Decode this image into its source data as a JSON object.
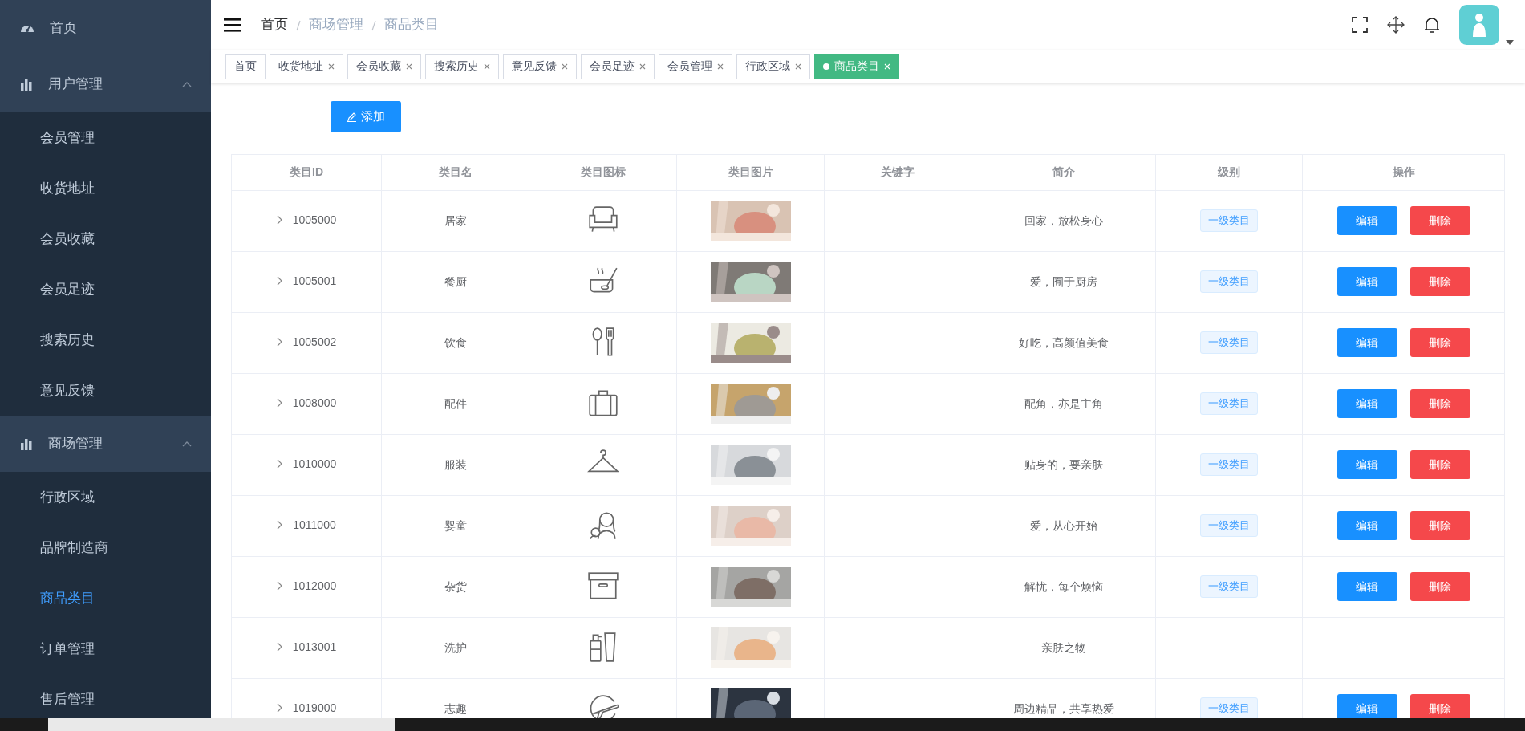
{
  "sidebar": {
    "items": [
      {
        "label": "首页",
        "kind": "link"
      },
      {
        "label": "用户管理",
        "kind": "group",
        "expanded": true,
        "children": [
          {
            "label": "会员管理",
            "selected": false
          },
          {
            "label": "收货地址",
            "selected": false
          },
          {
            "label": "会员收藏",
            "selected": false
          },
          {
            "label": "会员足迹",
            "selected": false
          },
          {
            "label": "搜索历史",
            "selected": false
          },
          {
            "label": "意见反馈",
            "selected": false
          }
        ]
      },
      {
        "label": "商场管理",
        "kind": "group",
        "expanded": true,
        "children": [
          {
            "label": "行政区域",
            "selected": false
          },
          {
            "label": "品牌制造商",
            "selected": false
          },
          {
            "label": "商品类目",
            "selected": true
          },
          {
            "label": "订单管理",
            "selected": false
          },
          {
            "label": "售后管理",
            "selected": false
          }
        ]
      }
    ]
  },
  "breadcrumb": [
    {
      "label": "首页",
      "link": true
    },
    {
      "label": "商场管理",
      "link": false
    },
    {
      "label": "商品类目",
      "link": false
    }
  ],
  "tabs": [
    {
      "label": "首页",
      "selected": false,
      "closable": false
    },
    {
      "label": "收货地址",
      "selected": false,
      "closable": true
    },
    {
      "label": "会员收藏",
      "selected": false,
      "closable": true
    },
    {
      "label": "搜索历史",
      "selected": false,
      "closable": true
    },
    {
      "label": "意见反馈",
      "selected": false,
      "closable": true
    },
    {
      "label": "会员足迹",
      "selected": false,
      "closable": true
    },
    {
      "label": "会员管理",
      "selected": false,
      "closable": true
    },
    {
      "label": "行政区域",
      "selected": false,
      "closable": true
    },
    {
      "label": "商品类目",
      "selected": true,
      "closable": true
    }
  ],
  "toolbar": {
    "add_button": "添加"
  },
  "table": {
    "columns": [
      "类目ID",
      "类目名",
      "类目图标",
      "类目图片",
      "关键字",
      "简介",
      "级别",
      "操作"
    ],
    "rows": [
      {
        "id": "1005000",
        "name": "居家",
        "description": "回家，放松身心",
        "level_tag": "一级类目",
        "actions": [
          {
            "label": "编辑",
            "kind": "edit"
          },
          {
            "label": "删除",
            "kind": "delete"
          }
        ]
      },
      {
        "id": "1005001",
        "name": "餐厨",
        "description": "爱，囿于厨房",
        "level_tag": "一级类目",
        "actions": [
          {
            "label": "编辑",
            "kind": "edit"
          },
          {
            "label": "删除",
            "kind": "delete"
          }
        ]
      },
      {
        "id": "1005002",
        "name": "饮食",
        "description": "好吃，高颜值美食",
        "level_tag": "一级类目",
        "actions": [
          {
            "label": "编辑",
            "kind": "edit"
          },
          {
            "label": "删除",
            "kind": "delete"
          }
        ]
      },
      {
        "id": "1008000",
        "name": "配件",
        "description": "配角，亦是主角",
        "level_tag": "一级类目",
        "actions": [
          {
            "label": "编辑",
            "kind": "edit"
          },
          {
            "label": "删除",
            "kind": "delete"
          }
        ]
      },
      {
        "id": "1010000",
        "name": "服装",
        "description": "贴身的，要亲肤",
        "level_tag": "一级类目",
        "actions": [
          {
            "label": "编辑",
            "kind": "edit"
          },
          {
            "label": "删除",
            "kind": "delete"
          }
        ]
      },
      {
        "id": "1011000",
        "name": "婴童",
        "description": "爱，从心开始",
        "level_tag": "一级类目",
        "actions": [
          {
            "label": "编辑",
            "kind": "edit"
          },
          {
            "label": "删除",
            "kind": "delete"
          }
        ]
      },
      {
        "id": "1012000",
        "name": "杂货",
        "description": "解忧，每个烦恼",
        "level_tag": "一级类目",
        "actions": [
          {
            "label": "编辑",
            "kind": "edit"
          },
          {
            "label": "删除",
            "kind": "delete"
          }
        ]
      },
      {
        "id": "1013001",
        "name": "洗护",
        "description": "亲肤之物"
      },
      {
        "id": "1019000",
        "name": "志趣",
        "description": "周边精品，共享热爱",
        "level_tag": "一级类目",
        "actions": [
          {
            "label": "编辑",
            "kind": "edit"
          },
          {
            "label": "删除",
            "kind": "delete"
          }
        ]
      }
    ]
  }
}
